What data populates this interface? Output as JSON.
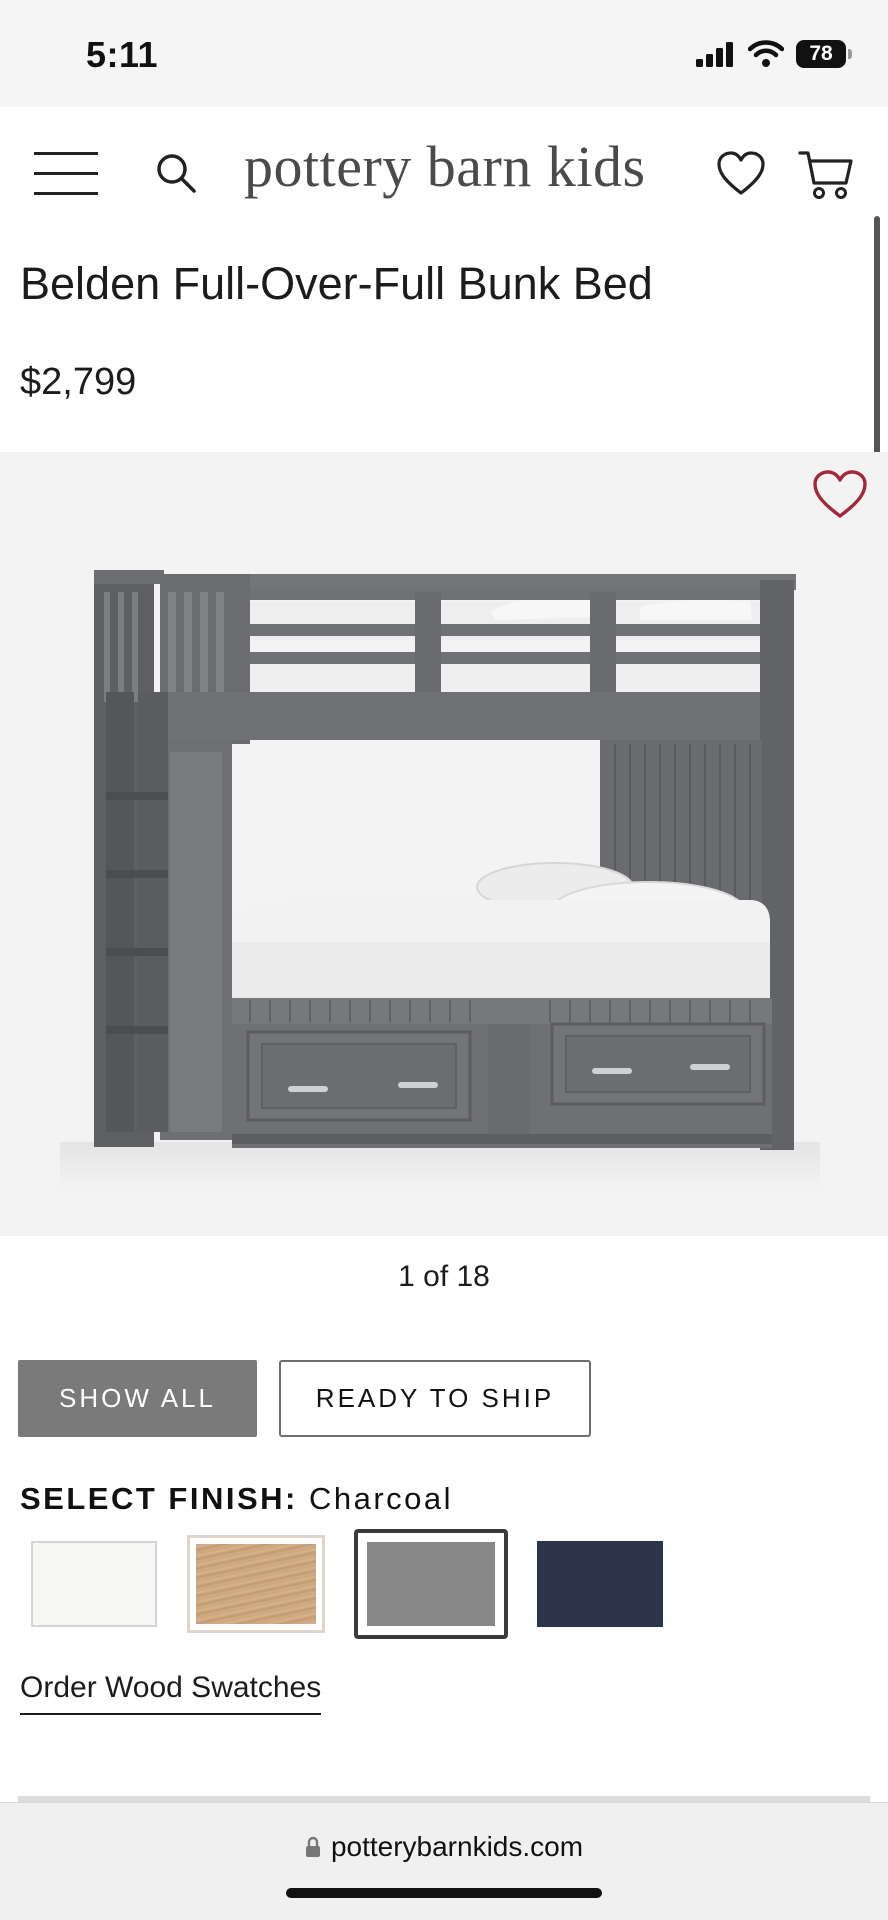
{
  "status": {
    "time": "5:11",
    "battery": "78"
  },
  "header": {
    "logo": "pottery barn kids"
  },
  "product": {
    "title": "Belden Full-Over-Full Bunk Bed",
    "price": "$2,799",
    "image_counter": "1 of 18"
  },
  "filters": {
    "show_all": "SHOW ALL",
    "ready_to_ship": "READY TO SHIP"
  },
  "finish": {
    "label": "SELECT FINISH:",
    "selected": "Charcoal",
    "swatches": [
      {
        "name": "white",
        "color": "#f6f6f4"
      },
      {
        "name": "natural-wood",
        "color": "#cfa97f"
      },
      {
        "name": "charcoal",
        "color": "#888888",
        "selected": true
      },
      {
        "name": "navy",
        "color": "#2b3448"
      }
    ]
  },
  "order_wood_swatches": "Order Wood Swatches",
  "browser": {
    "url": "potterybarnkids.com"
  },
  "colors": {
    "accent_heart": "#a3283b",
    "button_dark": "#7a7a7a",
    "bed_gray": "#6f7073"
  }
}
